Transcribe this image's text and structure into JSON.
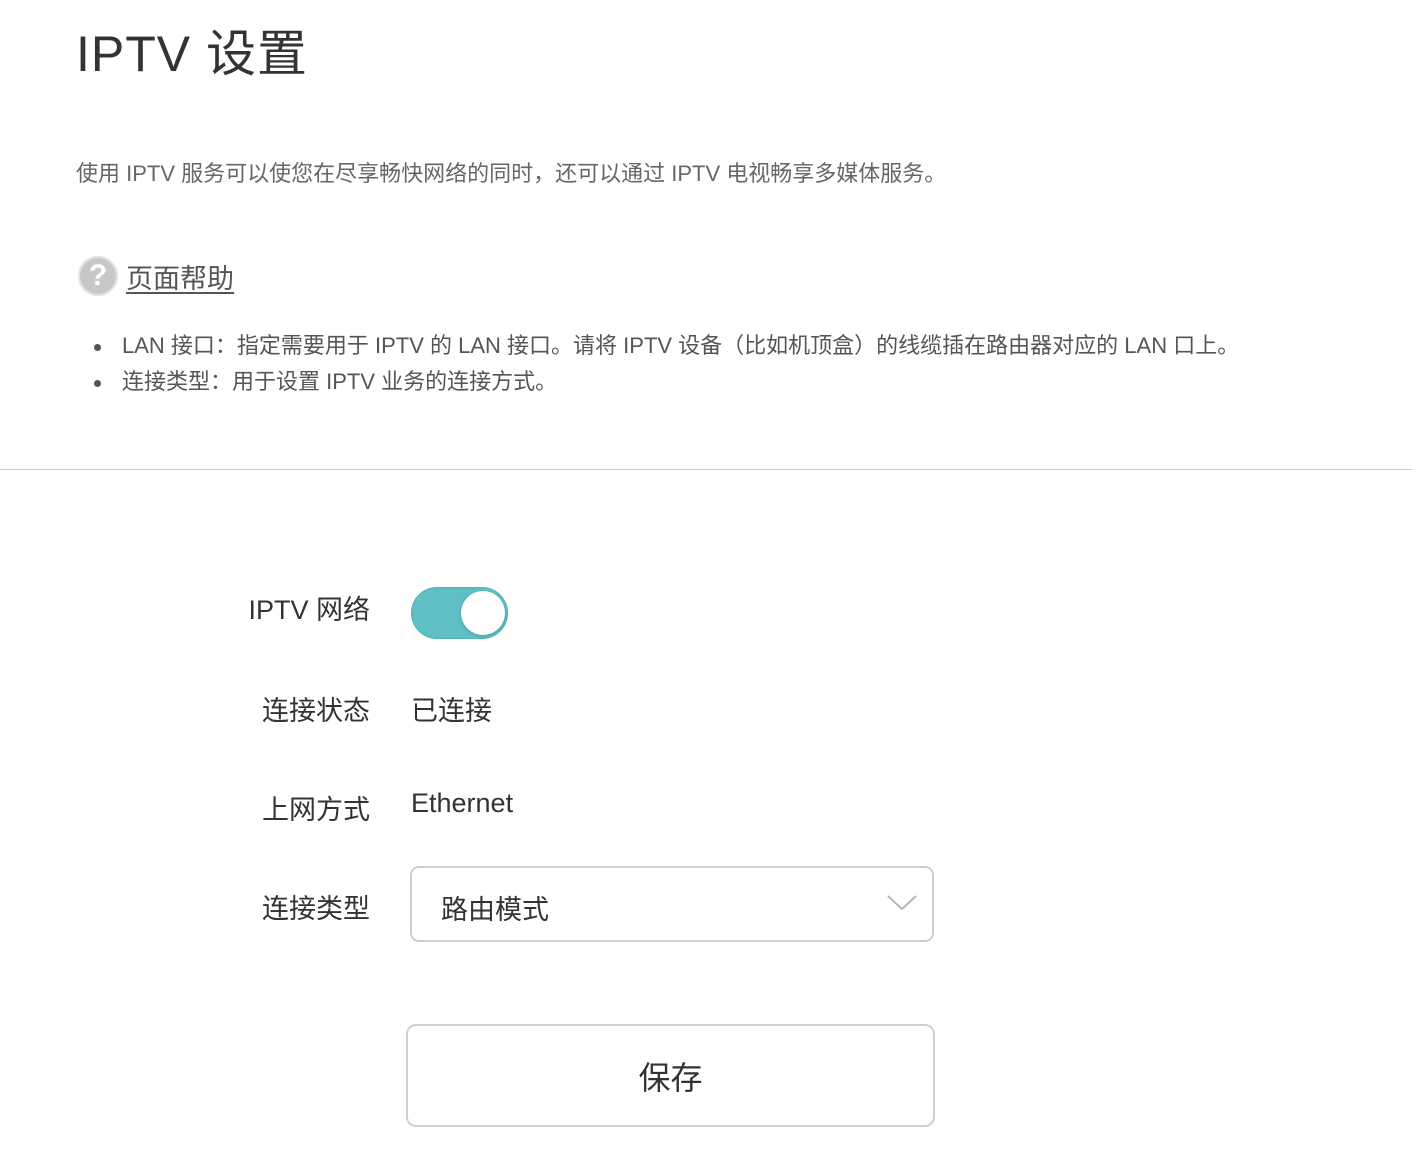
{
  "header": {
    "title": "IPTV 设置"
  },
  "intro": {
    "description": "使用 IPTV 服务可以使您在尽享畅快网络的同时，还可以通过 IPTV 电视畅享多媒体服务。"
  },
  "help": {
    "icon": "question-circle-icon",
    "link_label": "页面帮助",
    "items": [
      "LAN 接口：指定需要用于 IPTV 的 LAN 接口。请将 IPTV 设备（比如机顶盒）的线缆插在路由器对应的 LAN 口上。",
      "连接类型：用于设置 IPTV 业务的连接方式。"
    ]
  },
  "form": {
    "iptv_network": {
      "label": "IPTV 网络",
      "enabled": true
    },
    "connection_status": {
      "label": "连接状态",
      "value": "已连接"
    },
    "access_mode": {
      "label": "上网方式",
      "value": "Ethernet"
    },
    "connection_type": {
      "label": "连接类型",
      "value": "路由模式"
    },
    "save_label": "保存"
  },
  "colors": {
    "toggle_on": "#5fbfc4",
    "text": "#333333",
    "border": "#cfcfcf",
    "divider": "#cccccc"
  }
}
